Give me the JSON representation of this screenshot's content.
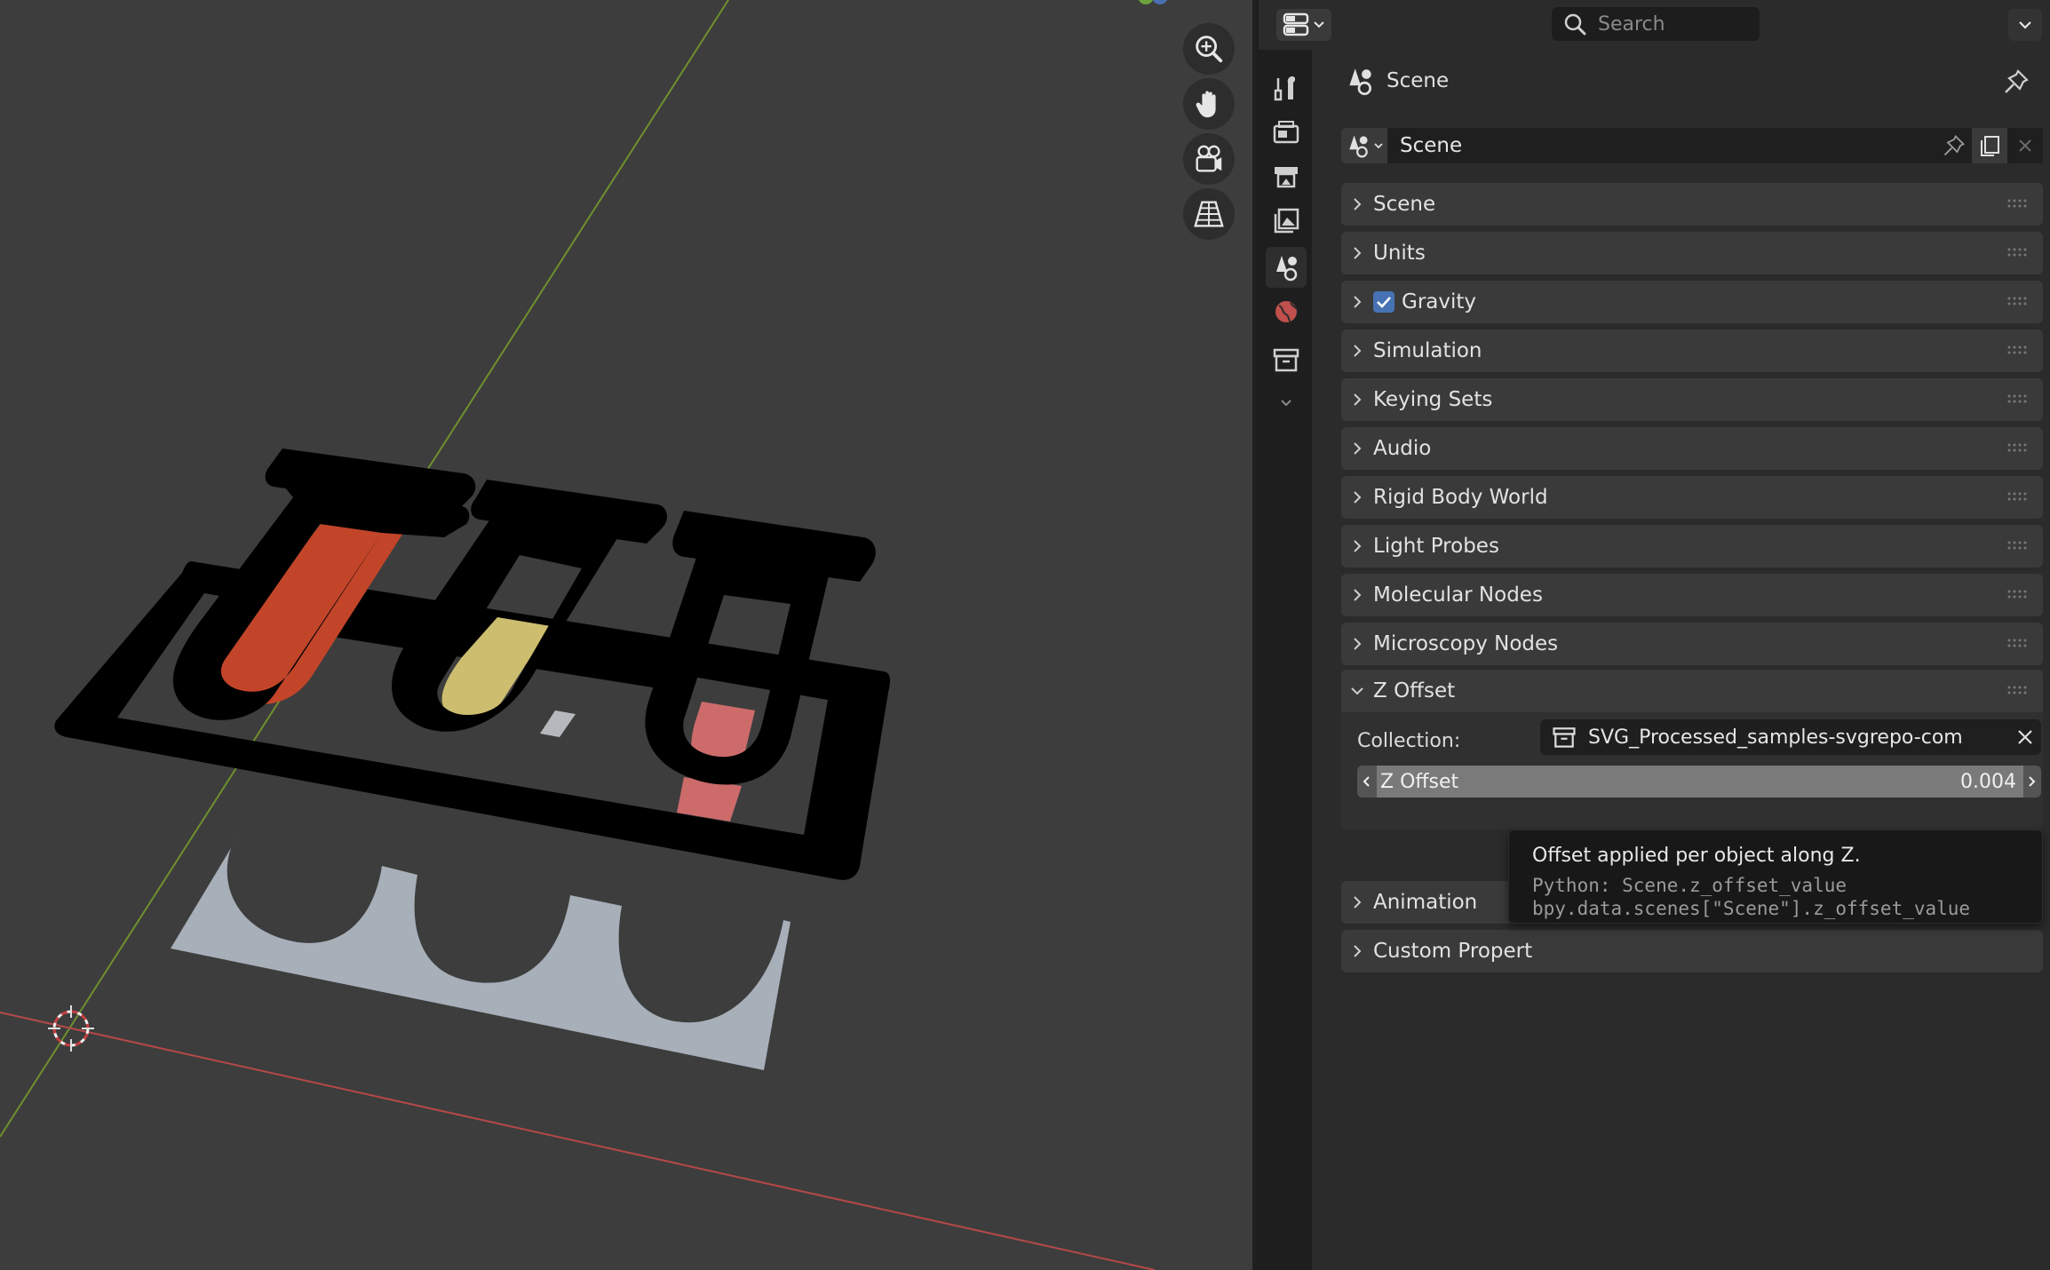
{
  "header": {
    "search_placeholder": "Search"
  },
  "context": {
    "title": "Scene",
    "datablock_name": "Scene"
  },
  "panels": [
    {
      "label": "Scene"
    },
    {
      "label": "Units"
    },
    {
      "label": "Gravity",
      "checked": true
    },
    {
      "label": "Simulation"
    },
    {
      "label": "Keying Sets"
    },
    {
      "label": "Audio"
    },
    {
      "label": "Rigid Body World"
    },
    {
      "label": "Light Probes"
    },
    {
      "label": "Molecular Nodes"
    },
    {
      "label": "Microscopy Nodes"
    }
  ],
  "z_offset_panel": {
    "label": "Z Offset",
    "collection_label": "Collection:",
    "collection_value": "SVG_Processed_samples-svgrepo-com",
    "slider_label": "Z Offset",
    "slider_value": "0.004"
  },
  "lower_panels": [
    {
      "label": "Animation"
    },
    {
      "label": "Custom Propert"
    }
  ],
  "tooltip": {
    "description": "Offset applied per object along Z.",
    "python_line1": "Python: Scene.z_offset_value",
    "python_line2": "bpy.data.scenes[\"Scene\"].z_offset_value"
  },
  "colors": {
    "accent": "#4772b3",
    "viewport_bg": "#3d3d3d",
    "x_axis": "#b64848",
    "y_axis": "#6f8f2e"
  }
}
